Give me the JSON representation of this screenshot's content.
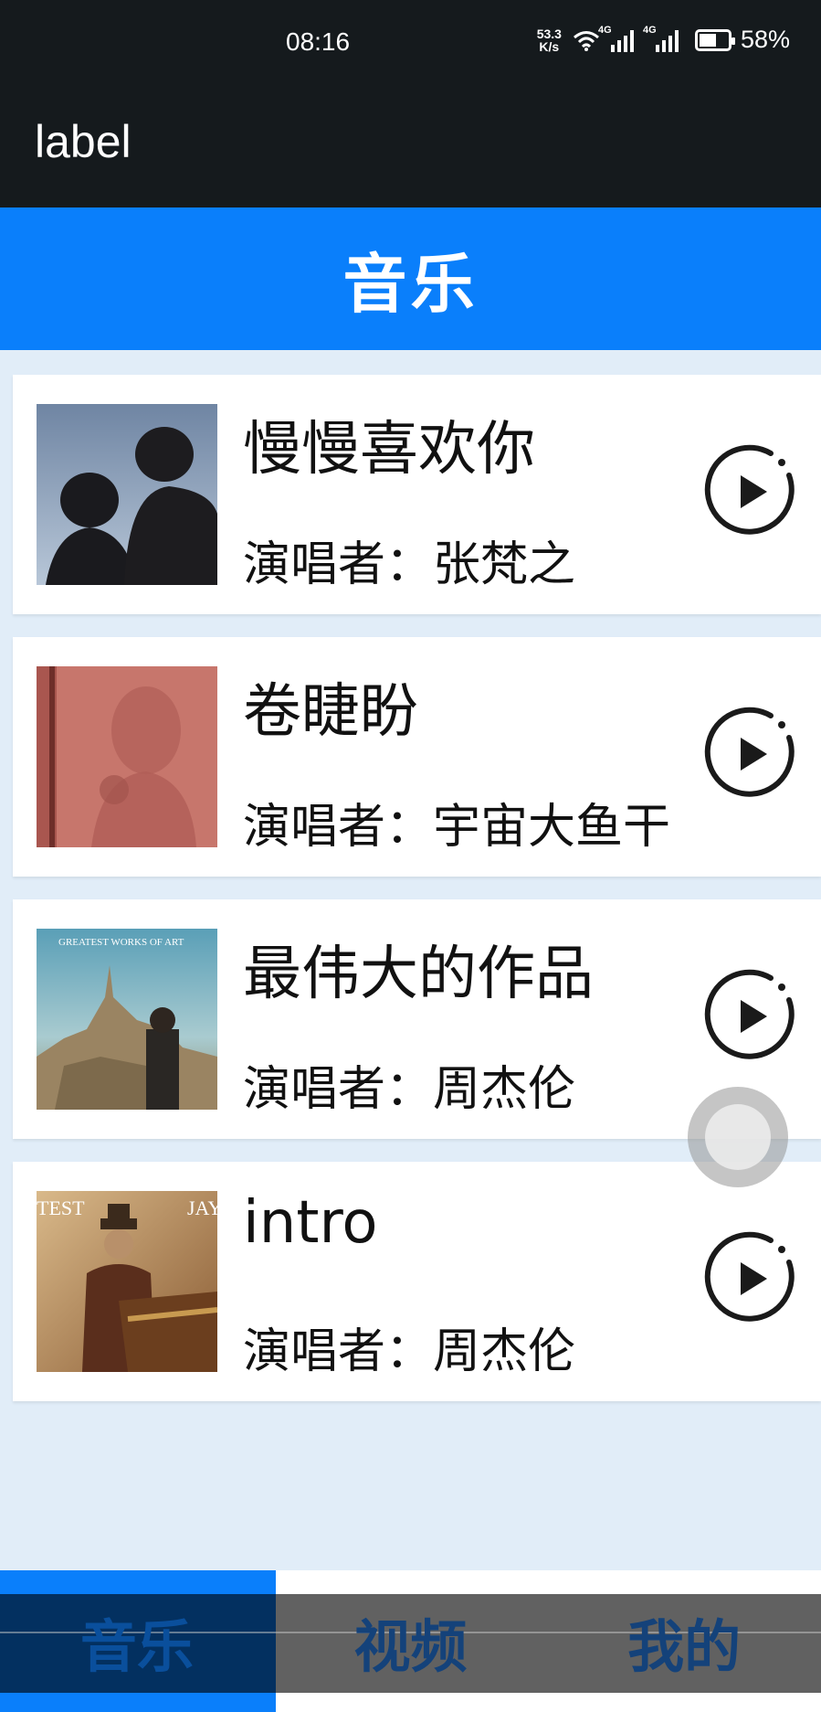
{
  "status_bar": {
    "time": "08:16",
    "net_speed_value": "53.3",
    "net_speed_unit": "K/s",
    "wifi_tag": "6",
    "signal1_tag": "4G",
    "signal2_tag": "4G",
    "battery_percent": "58%"
  },
  "app_bar": {
    "label": "label"
  },
  "header": {
    "title": "音乐"
  },
  "songs": [
    {
      "title": "慢慢喜欢你",
      "artist": "演唱者：张梵之",
      "cover_icon": "album-cover-silhouette-couple"
    },
    {
      "title": "卷睫盼",
      "artist": "演唱者：宇宙大鱼干",
      "cover_icon": "album-cover-shadow-on-wall"
    },
    {
      "title": "最伟大的作品",
      "artist": "演唱者：周杰伦",
      "cover_icon": "album-cover-castle"
    },
    {
      "title": "intro",
      "artist": "演唱者：周杰伦",
      "cover_icon": "album-cover-piano"
    }
  ],
  "cover_texts": {
    "song3_top": "GREATEST WORKS OF ART",
    "song4_left": "TEST",
    "song4_right": "JAY"
  },
  "tabs": [
    {
      "label": "音乐",
      "active": true
    },
    {
      "label": "视频",
      "active": false
    },
    {
      "label": "我的",
      "active": false
    }
  ],
  "colors": {
    "accent": "#0a7ffb",
    "bar_dark": "#151a1d",
    "background": "#e1edf8"
  }
}
